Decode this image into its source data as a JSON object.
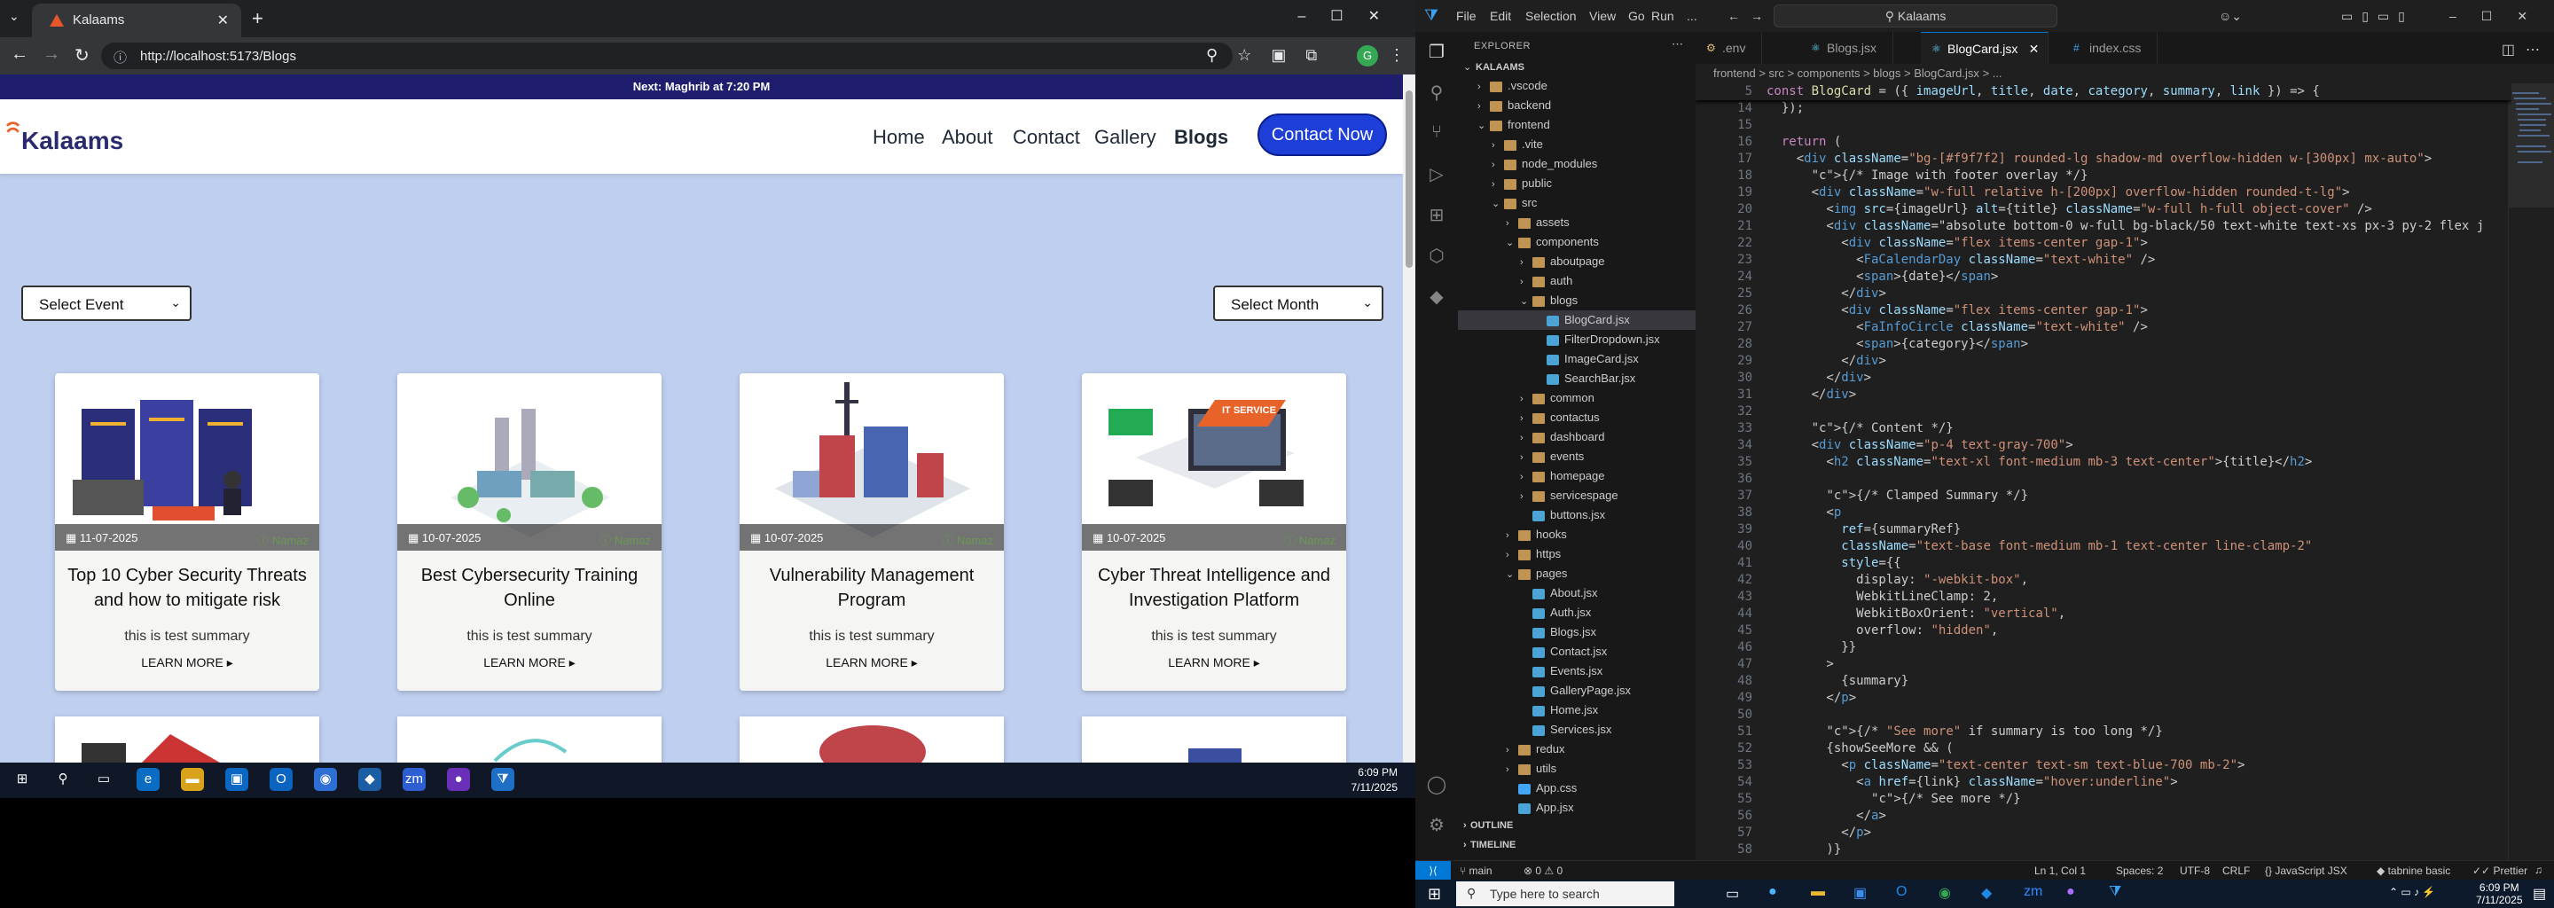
{
  "browser": {
    "tab_title": "Kalaams",
    "url": "http://localhost:5173/Blogs",
    "profile_initial": "G"
  },
  "site": {
    "notice": "Next: Maghrib at 7:20 PM",
    "logo": "Kalaams",
    "nav": [
      "Home",
      "About",
      "Contact",
      "Gallery",
      "Blogs"
    ],
    "contact_button": "Contact Now",
    "select_event": "Select Event",
    "select_month": "Select Month",
    "cards": [
      {
        "date": "11-07-2025",
        "category": "Namaz",
        "title": "Top 10 Cyber Security Threats and how to mitigate risk",
        "summary": "this is test summary",
        "more": "LEARN MORE"
      },
      {
        "date": "10-07-2025",
        "category": "Namaz",
        "title": "Best Cybersecurity Training Online",
        "summary": "this is test summary",
        "more": "LEARN MORE"
      },
      {
        "date": "10-07-2025",
        "category": "Namaz",
        "title": "Vulnerability Management Program",
        "summary": "this is test summary",
        "more": "LEARN MORE"
      },
      {
        "date": "10-07-2025",
        "category": "Namaz",
        "title": "Cyber Threat Intelligence and Investigation Platform",
        "summary": "this is test summary",
        "more": "LEARN MORE"
      }
    ],
    "card_badge_text": "IT SERVICE"
  },
  "left_taskbar": {
    "time": "6:09 PM",
    "date": "7/11/2025"
  },
  "vscode": {
    "menu": [
      "File",
      "Edit",
      "Selection",
      "View",
      "Go",
      "Run",
      "..."
    ],
    "search": "Kalaams",
    "explorer_title": "EXPLORER",
    "tree": [
      {
        "label": "KALAAMS",
        "depth": 0,
        "type": "root"
      },
      {
        "label": ".vscode",
        "depth": 1,
        "type": "folder"
      },
      {
        "label": "backend",
        "depth": 1,
        "type": "folder"
      },
      {
        "label": "frontend",
        "depth": 1,
        "type": "folder-open"
      },
      {
        "label": ".vite",
        "depth": 2,
        "type": "folder"
      },
      {
        "label": "node_modules",
        "depth": 2,
        "type": "folder"
      },
      {
        "label": "public",
        "depth": 2,
        "type": "folder"
      },
      {
        "label": "src",
        "depth": 2,
        "type": "folder-open"
      },
      {
        "label": "assets",
        "depth": 3,
        "type": "folder"
      },
      {
        "label": "components",
        "depth": 3,
        "type": "folder-open"
      },
      {
        "label": "aboutpage",
        "depth": 4,
        "type": "folder"
      },
      {
        "label": "auth",
        "depth": 4,
        "type": "folder"
      },
      {
        "label": "blogs",
        "depth": 4,
        "type": "folder-open"
      },
      {
        "label": "BlogCard.jsx",
        "depth": 5,
        "type": "file",
        "selected": true
      },
      {
        "label": "FilterDropdown.jsx",
        "depth": 5,
        "type": "file"
      },
      {
        "label": "ImageCard.jsx",
        "depth": 5,
        "type": "file"
      },
      {
        "label": "SearchBar.jsx",
        "depth": 5,
        "type": "file"
      },
      {
        "label": "common",
        "depth": 4,
        "type": "folder"
      },
      {
        "label": "contactus",
        "depth": 4,
        "type": "folder"
      },
      {
        "label": "dashboard",
        "depth": 4,
        "type": "folder"
      },
      {
        "label": "events",
        "depth": 4,
        "type": "folder"
      },
      {
        "label": "homepage",
        "depth": 4,
        "type": "folder"
      },
      {
        "label": "servicespage",
        "depth": 4,
        "type": "folder"
      },
      {
        "label": "buttons.jsx",
        "depth": 4,
        "type": "file"
      },
      {
        "label": "hooks",
        "depth": 3,
        "type": "folder"
      },
      {
        "label": "https",
        "depth": 3,
        "type": "folder"
      },
      {
        "label": "pages",
        "depth": 3,
        "type": "folder-open"
      },
      {
        "label": "About.jsx",
        "depth": 4,
        "type": "file"
      },
      {
        "label": "Auth.jsx",
        "depth": 4,
        "type": "file"
      },
      {
        "label": "Blogs.jsx",
        "depth": 4,
        "type": "file"
      },
      {
        "label": "Contact.jsx",
        "depth": 4,
        "type": "file"
      },
      {
        "label": "Events.jsx",
        "depth": 4,
        "type": "file"
      },
      {
        "label": "GalleryPage.jsx",
        "depth": 4,
        "type": "file"
      },
      {
        "label": "Home.jsx",
        "depth": 4,
        "type": "file"
      },
      {
        "label": "Services.jsx",
        "depth": 4,
        "type": "file"
      },
      {
        "label": "redux",
        "depth": 3,
        "type": "folder"
      },
      {
        "label": "utils",
        "depth": 3,
        "type": "folder"
      },
      {
        "label": "App.css",
        "depth": 3,
        "type": "file"
      },
      {
        "label": "App.jsx",
        "depth": 3,
        "type": "file"
      }
    ],
    "outline": "OUTLINE",
    "timeline": "TIMELINE",
    "tabs": [
      ".env",
      "Blogs.jsx",
      "BlogCard.jsx",
      "index.css"
    ],
    "active_tab": "BlogCard.jsx",
    "breadcrumb": "frontend > src > components > blogs > BlogCard.jsx > ...",
    "sticky_line": {
      "n": 5,
      "text": "const BlogCard = ({ imageUrl, title, date, category, summary, link }) => {"
    },
    "code": [
      {
        "n": 14,
        "text": "  });"
      },
      {
        "n": 15,
        "text": ""
      },
      {
        "n": 16,
        "text": "  return ("
      },
      {
        "n": 17,
        "text": "    <div className=\"bg-[#f9f7f2] rounded-lg shadow-md overflow-hidden w-[300px] mx-auto\">"
      },
      {
        "n": 18,
        "text": "      {/* Image with footer overlay */}"
      },
      {
        "n": 19,
        "text": "      <div className=\"w-full relative h-[200px] overflow-hidden rounded-t-lg\">"
      },
      {
        "n": 20,
        "text": "        <img src={imageUrl} alt={title} className=\"w-full h-full object-cover\" />"
      },
      {
        "n": 21,
        "text": "        <div className=\"absolute bottom-0 w-full bg-black/50 text-white text-xs px-3 py-2 flex j"
      },
      {
        "n": 22,
        "text": "          <div className=\"flex items-center gap-1\">"
      },
      {
        "n": 23,
        "text": "            <FaCalendarDay className=\"text-white\" />"
      },
      {
        "n": 24,
        "text": "            <span>{date}</span>"
      },
      {
        "n": 25,
        "text": "          </div>"
      },
      {
        "n": 26,
        "text": "          <div className=\"flex items-center gap-1\">"
      },
      {
        "n": 27,
        "text": "            <FaInfoCircle className=\"text-white\" />"
      },
      {
        "n": 28,
        "text": "            <span>{category}</span>"
      },
      {
        "n": 29,
        "text": "          </div>"
      },
      {
        "n": 30,
        "text": "        </div>"
      },
      {
        "n": 31,
        "text": "      </div>"
      },
      {
        "n": 32,
        "text": ""
      },
      {
        "n": 33,
        "text": "      {/* Content */}"
      },
      {
        "n": 34,
        "text": "      <div className=\"p-4 text-gray-700\">"
      },
      {
        "n": 35,
        "text": "        <h2 className=\"text-xl font-medium mb-3 text-center\">{title}</h2>"
      },
      {
        "n": 36,
        "text": ""
      },
      {
        "n": 37,
        "text": "        {/* Clamped Summary */}"
      },
      {
        "n": 38,
        "text": "        <p"
      },
      {
        "n": 39,
        "text": "          ref={summaryRef}"
      },
      {
        "n": 40,
        "text": "          className=\"text-base font-medium mb-1 text-center line-clamp-2\""
      },
      {
        "n": 41,
        "text": "          style={{"
      },
      {
        "n": 42,
        "text": "            display: \"-webkit-box\","
      },
      {
        "n": 43,
        "text": "            WebkitLineClamp: 2,"
      },
      {
        "n": 44,
        "text": "            WebkitBoxOrient: \"vertical\","
      },
      {
        "n": 45,
        "text": "            overflow: \"hidden\","
      },
      {
        "n": 46,
        "text": "          }}"
      },
      {
        "n": 47,
        "text": "        >"
      },
      {
        "n": 48,
        "text": "          {summary}"
      },
      {
        "n": 49,
        "text": "        </p>"
      },
      {
        "n": 50,
        "text": ""
      },
      {
        "n": 51,
        "text": "        {/* \"See more\" if summary is too long */}"
      },
      {
        "n": 52,
        "text": "        {showSeeMore && ("
      },
      {
        "n": 53,
        "text": "          <p className=\"text-center text-sm text-blue-700 mb-2\">"
      },
      {
        "n": 54,
        "text": "            <a href={link} className=\"hover:underline\">"
      },
      {
        "n": 55,
        "text": "              {/* See more */}"
      },
      {
        "n": 56,
        "text": "            </a>"
      },
      {
        "n": 57,
        "text": "          </p>"
      },
      {
        "n": 58,
        "text": "        )}"
      }
    ],
    "status": {
      "branch": "main",
      "problems": "0 ⚠ 0",
      "position": "Ln 1, Col 1",
      "spaces": "Spaces: 2",
      "encoding": "UTF-8",
      "eol": "CRLF",
      "language": "JavaScript JSX",
      "tabnine": "tabnine basic",
      "prettier": "Prettier"
    }
  },
  "right_taskbar": {
    "search": "Type here to search",
    "time": "6:09 PM",
    "date": "7/11/2025"
  },
  "colors": {
    "brand_blue": "#1d3fd7",
    "page_bg": "#bfcfef",
    "notice_bg": "#1f1e6e",
    "vscode_accent": "#0078d4"
  }
}
